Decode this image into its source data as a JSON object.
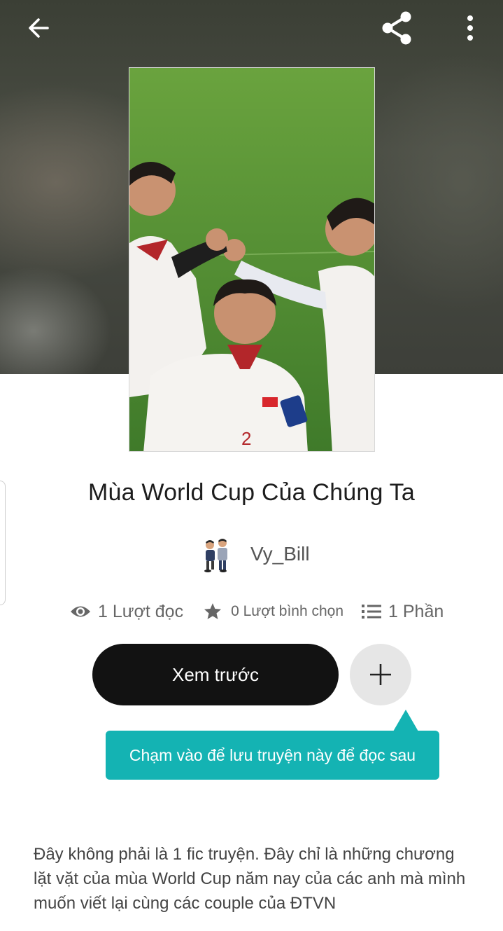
{
  "header": {
    "back_icon": "arrow-left-icon",
    "share_icon": "share-icon",
    "more_icon": "more-vertical-icon"
  },
  "story": {
    "title": "Mùa World Cup Của Chúng Ta",
    "author": "Vy_Bill",
    "stats": {
      "reads": "1 Lượt đọc",
      "votes": "0 Lượt bình chọn",
      "parts": "1 Phần"
    },
    "description": "Đây không phải là 1 fic truyện. Đây chỉ là những chương lặt vặt của mùa World Cup năm nay của các anh mà mình muốn viết lại cùng các couple của ĐTVN"
  },
  "actions": {
    "preview_label": "Xem trước",
    "add_icon": "plus-icon"
  },
  "tooltip": {
    "text": "Chạm vào để lưu truyện này để đọc sau"
  },
  "colors": {
    "accent": "#14b3b3",
    "primary_button": "#121212",
    "secondary_button": "#e6e6e6"
  }
}
